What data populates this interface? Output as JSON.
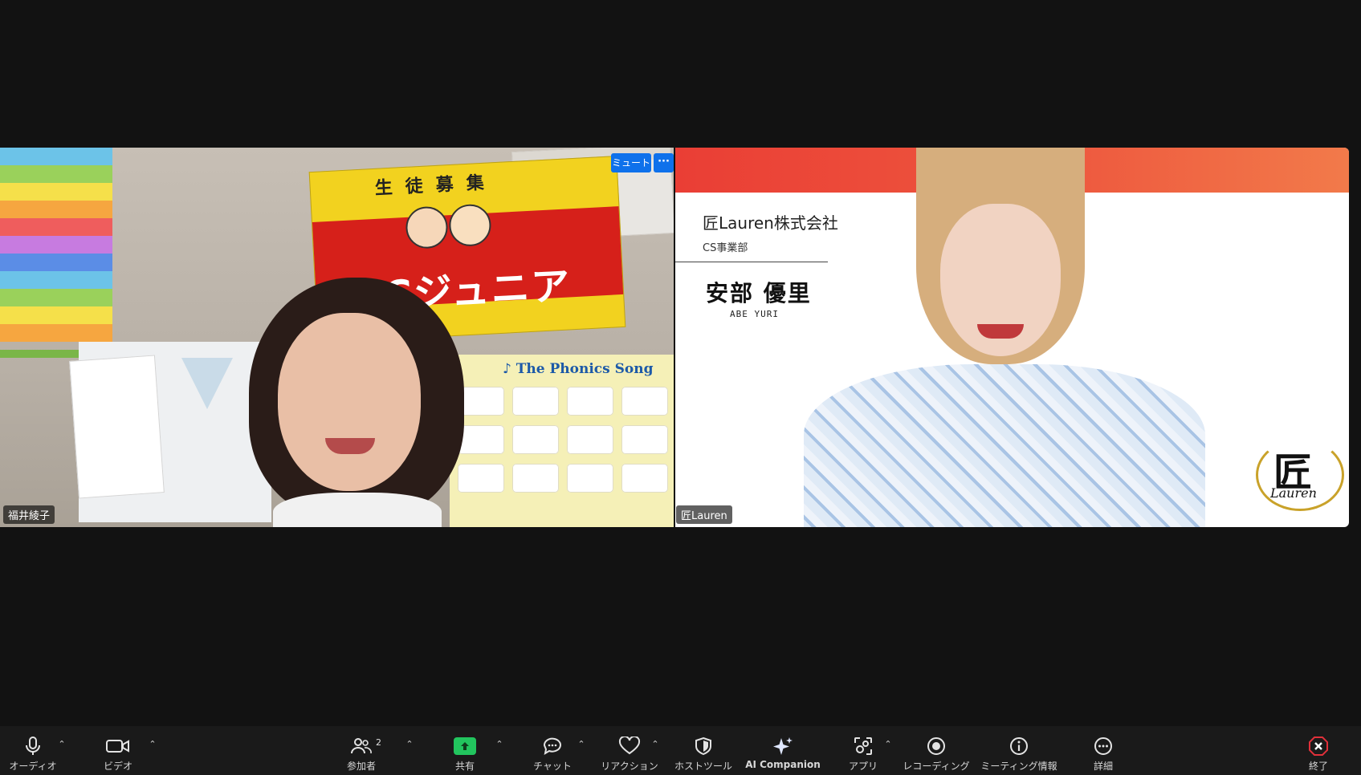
{
  "window": {
    "background": "#121212"
  },
  "tiles": {
    "left": {
      "name": "福井綾子",
      "mute_label": "ミュート",
      "more_label": "···",
      "sign_text": "ECCジュニア",
      "sign_top": "生徒募集",
      "poster_title": "♪ The Phonics Song"
    },
    "right": {
      "name": "匠Lauren",
      "company": "匠Lauren株式会社",
      "department": "CS事業部",
      "person_name": "安部 優里",
      "person_romaji": "ABE YURI",
      "logo_char": "匠",
      "logo_word": "Lauren",
      "accent": "#ea3e35"
    }
  },
  "toolbar": {
    "audio": "オーディオ",
    "video": "ビデオ",
    "participants": "参加者",
    "participants_count": "2",
    "share": "共有",
    "chat": "チャット",
    "reactions": "リアクション",
    "host_tools": "ホストツール",
    "ai_companion": "AI Companion",
    "apps": "アプリ",
    "recording": "レコーディング",
    "meeting_info": "ミーティング情報",
    "more": "詳細",
    "end": "終了",
    "share_color": "#22c55e",
    "end_color": "#e0303a"
  }
}
